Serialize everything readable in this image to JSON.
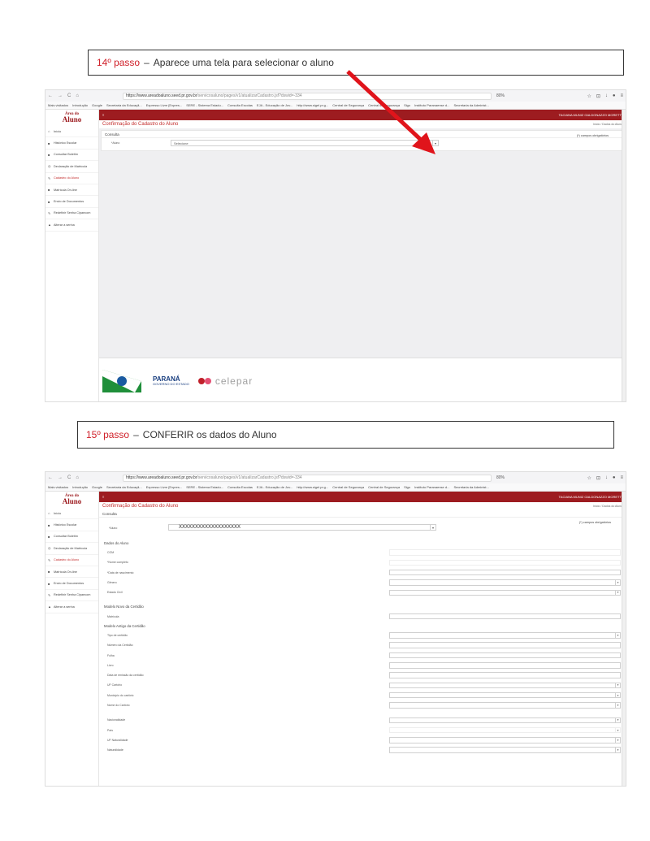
{
  "step14": {
    "number": "14º passo",
    "dash": "–",
    "text": "Aparece uma tela para selecionar o aluno"
  },
  "step15": {
    "number": "15º passo",
    "dash": "–",
    "text": "CONFERIR os dados do Aluno"
  },
  "colors": {
    "accent": "#9d1c20",
    "step_number": "#d0202a",
    "arrow": "#e0141b"
  },
  "browser": {
    "nav_glyphs": [
      "←",
      "→",
      "C",
      "⌂"
    ],
    "url_host": "https://www.areadoaluno.seed.pr.gov.br",
    "url_path": "/servicosaluno/pages/v1/atualizarCadastro.jsf?dswid=-334",
    "zoom": "80%",
    "tool_glyphs": [
      "☆",
      "⊡",
      "↓",
      "●",
      "≡"
    ],
    "bookmarks": [
      "Mais visitados",
      "Introdução",
      "Google",
      "Secretaria da Educaçã...",
      "Expresso Livre [Expres...",
      "SERE - Sistema Estadu...",
      "Consulta Escolas",
      "EJA - Educação de Jov...",
      "http://www.sigel.pr.g...",
      "Central de Segurança",
      "Central de Segurança",
      "Sigo",
      "Instituto Paranaense d...",
      "Secretaria da Administ..."
    ]
  },
  "app": {
    "logo_top": "Área do",
    "logo_bottom": "Aluno",
    "menu_glyph": "≡",
    "user": "TACIANA MUNIZ GALDONAZZO MORETTI",
    "page_title": "Confirmação do Cadastro do Aluno",
    "breadcrumb": "Início / Dados do Aluno",
    "panel_title": "Consulta",
    "select_label": "*Aluno",
    "select_value_1": "Selecione",
    "select_value_2": "XXXXXXXXXXXXXXXXXXX",
    "required_note": "(*) campos obrigatórios",
    "arrow_glyph": "▾",
    "sidebar": [
      {
        "icon": "⌂",
        "label": "Início"
      },
      {
        "icon": "■",
        "label": "Histórico Escolar"
      },
      {
        "icon": "■",
        "label": "Consultar Boletim"
      },
      {
        "icon": "◎",
        "label": "Declaração de Matrícula"
      },
      {
        "icon": "✎",
        "label": "Cadastro do Aluno"
      },
      {
        "icon": "■",
        "label": "Matrícula On-line"
      },
      {
        "icon": "■",
        "label": "Envio de Documentos"
      },
      {
        "icon": "✎",
        "label": "Redefinir Senha Cipaecom"
      },
      {
        "icon": "▲",
        "label": "Alterar a senha"
      }
    ],
    "footer": {
      "parana": "PARANÁ",
      "parana_sub": "GOVERNO DO ESTADO",
      "celepar": "celepar"
    }
  },
  "form": {
    "section_dados": "Dados do Aluno",
    "dados_fields": [
      {
        "label": "CGM",
        "type": "text",
        "hidden_box": true
      },
      {
        "label": "*Nome completo",
        "type": "text",
        "hidden_box": true
      },
      {
        "label": "*Data de nascimento",
        "type": "text"
      },
      {
        "label": "Gênero",
        "type": "select"
      },
      {
        "label": "Estado Civil",
        "type": "select"
      }
    ],
    "section_novo": "Modelo Novo da Certidão",
    "novo_fields": [
      {
        "label": "Matrícula",
        "type": "text"
      }
    ],
    "section_antigo": "Modelo Antigo da Certidão",
    "antigo_fields": [
      {
        "label": "Tipo de certidão",
        "type": "select"
      },
      {
        "label": "Número da Certidão",
        "type": "text"
      },
      {
        "label": "Folha",
        "type": "text"
      },
      {
        "label": "Livro",
        "type": "text"
      },
      {
        "label": "Data de emissão da certidão",
        "type": "text"
      },
      {
        "label": "UF Cartório",
        "type": "select"
      },
      {
        "label": "Município do cartório",
        "type": "select"
      },
      {
        "label": "Nome do Cartório",
        "type": "select"
      }
    ],
    "extra_fields": [
      {
        "label": "Nacionalidade",
        "type": "select"
      },
      {
        "label": "País",
        "type": "select"
      },
      {
        "label": "UF Naturalidade",
        "type": "select"
      },
      {
        "label": "Naturalidade",
        "type": "select"
      }
    ]
  }
}
